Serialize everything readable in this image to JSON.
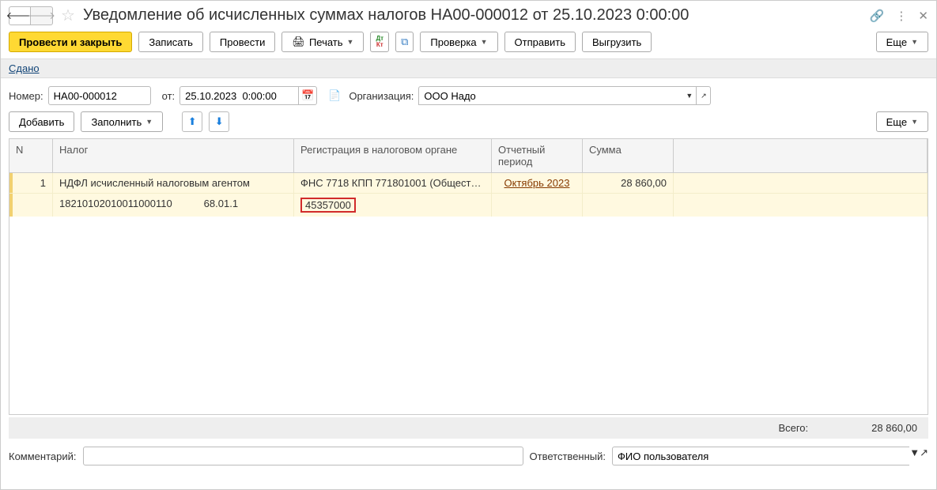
{
  "header": {
    "title": "Уведомление об исчисленных суммах налогов НА00-000012 от 25.10.2023 0:00:00"
  },
  "toolbar": {
    "post_and_close": "Провести и закрыть",
    "save": "Записать",
    "post": "Провести",
    "print": "Печать",
    "check": "Проверка",
    "send": "Отправить",
    "export": "Выгрузить",
    "more": "Еще"
  },
  "status": {
    "label": "Сдано"
  },
  "form": {
    "number_label": "Номер:",
    "number_value": "НА00-000012",
    "from_label": "от:",
    "date_value": "25.10.2023  0:00:00",
    "org_label": "Организация:",
    "org_value": "ООО Надо"
  },
  "actions": {
    "add": "Добавить",
    "fill": "Заполнить",
    "more": "Еще"
  },
  "table": {
    "headers": {
      "n": "N",
      "tax": "Налог",
      "reg": "Регистрация в налоговом органе",
      "period": "Отчетный период",
      "sum": "Сумма"
    },
    "row": {
      "n": "1",
      "tax_name": "НДФЛ исчисленный налоговым агентом",
      "reg": "ФНС 7718 КПП 771801001 (Общест…",
      "period": "Октябрь 2023",
      "sum": "28 860,00",
      "kbk": "18210102010011000110",
      "account": "68.01.1",
      "oktmo": "45357000"
    }
  },
  "totals": {
    "label": "Всего:",
    "value": "28 860,00"
  },
  "footer": {
    "comment_label": "Комментарий:",
    "responsible_label": "Ответственный:",
    "responsible_value": "ФИО пользователя"
  }
}
